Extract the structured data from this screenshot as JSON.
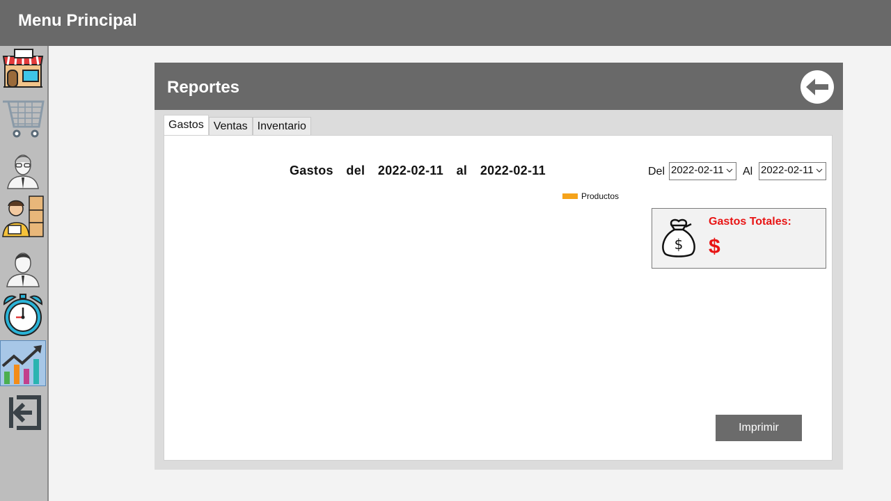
{
  "app": {
    "title": "Menu Principal"
  },
  "sidebar": {
    "items": [
      {
        "icon": "store-icon"
      },
      {
        "icon": "shopping-cart-icon"
      },
      {
        "icon": "user-manager-icon"
      },
      {
        "icon": "warehouse-worker-icon"
      },
      {
        "icon": "employee-icon"
      },
      {
        "icon": "alarm-clock-icon"
      },
      {
        "icon": "reports-chart-icon",
        "active": true
      },
      {
        "icon": "logout-icon"
      }
    ]
  },
  "panel": {
    "title": "Reportes",
    "back_icon": "arrow-left-icon",
    "tabs": [
      {
        "label": "Gastos",
        "active": true
      },
      {
        "label": "Ventas",
        "active": false
      },
      {
        "label": "Inventario",
        "active": false
      }
    ]
  },
  "report": {
    "title": "Gastos  del  2022-02-11  al  2022-02-11",
    "legend_label": "Productos",
    "legend_color": "#f5a31a",
    "from_label": "Del",
    "from_value": "2022-02-11",
    "to_label": "Al",
    "to_value": "2022-02-11",
    "total_label": "Gastos Totales:",
    "total_value": "$",
    "total_color": "#e81414",
    "print_label": "Imprimir"
  },
  "chart_data": {
    "type": "bar",
    "title": "Gastos  del  2022-02-11  al  2022-02-11",
    "series": [
      {
        "name": "Productos",
        "values": []
      }
    ],
    "categories": []
  }
}
